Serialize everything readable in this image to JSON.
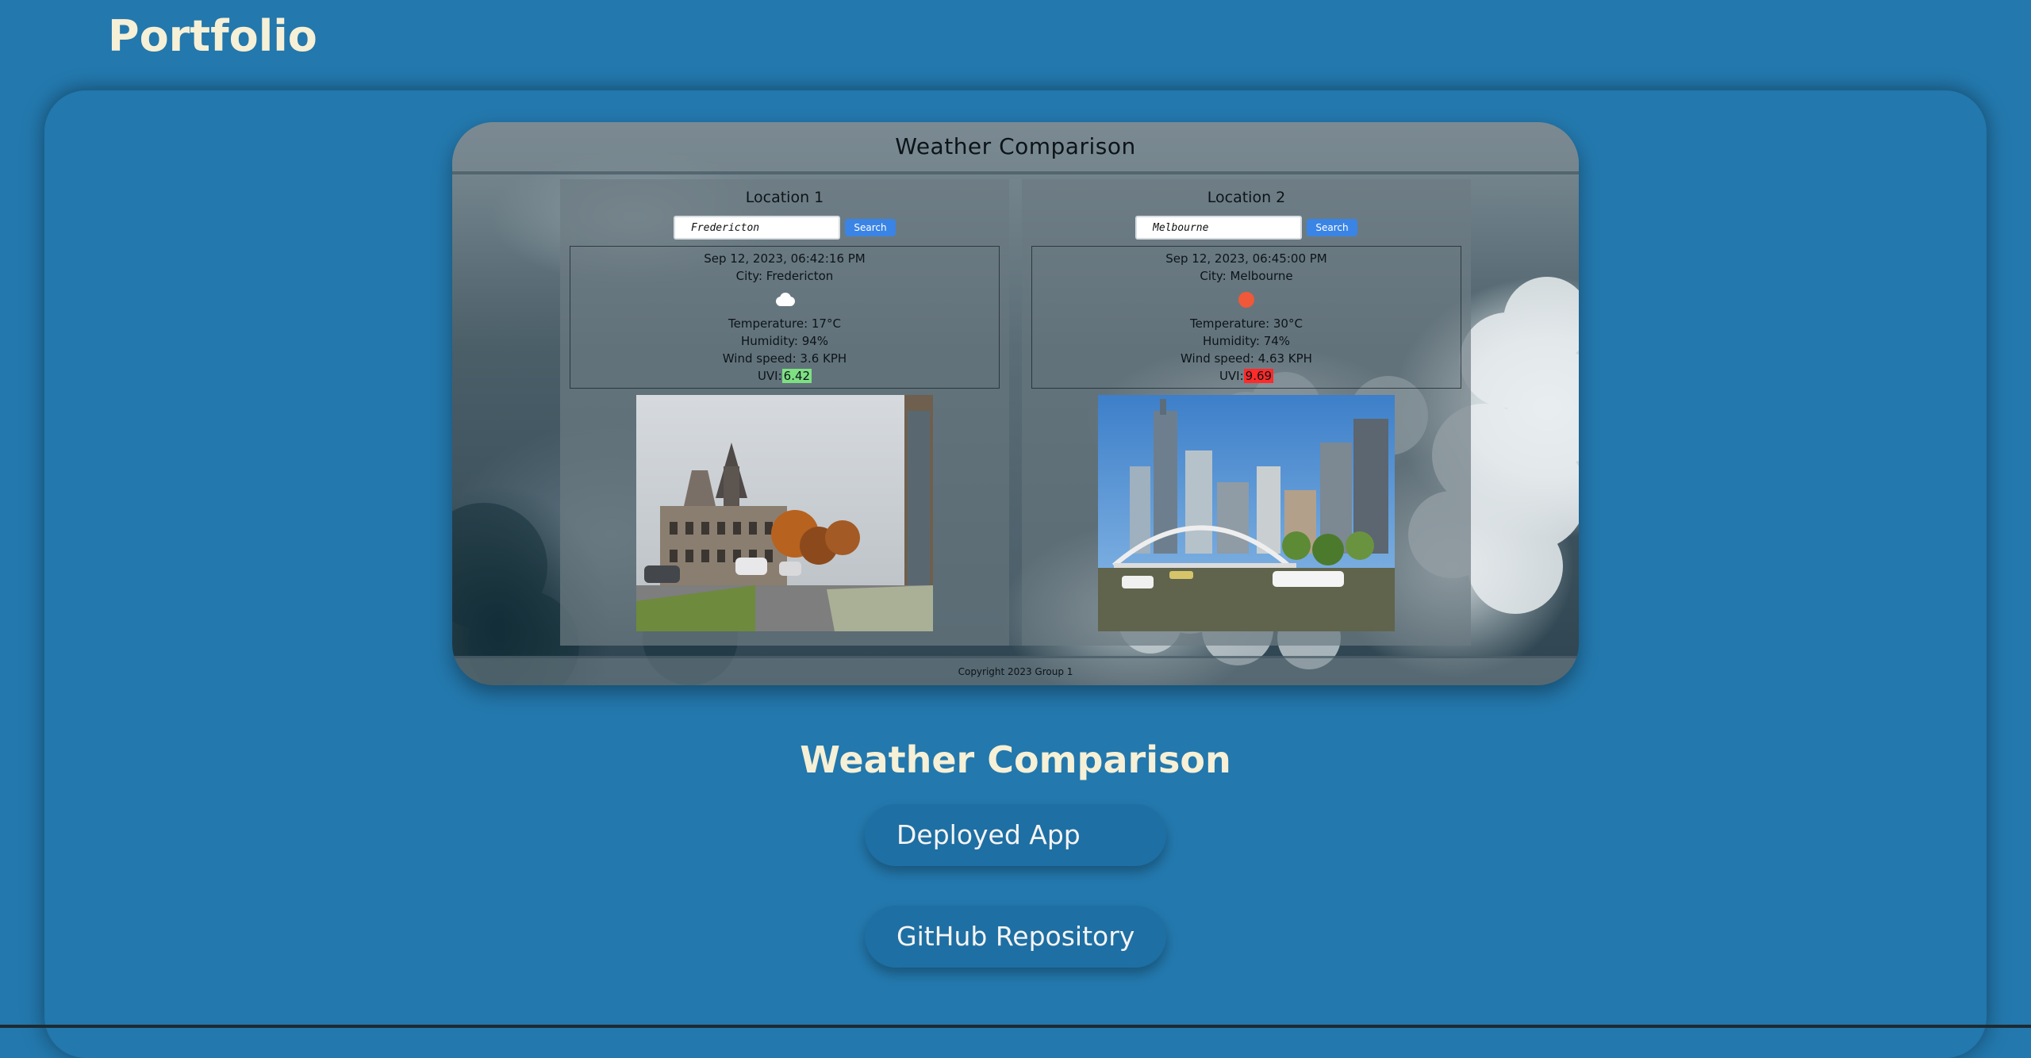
{
  "page": {
    "title": "Portfolio"
  },
  "screenshot": {
    "app_title": "Weather Comparison",
    "footer": "Copyright 2023 Group 1",
    "locations": [
      {
        "heading": "Location 1",
        "search_value": "Fredericton",
        "search_button": "Search",
        "datetime": "Sep 12, 2023, 06:42:16 PM",
        "city": "City: Fredericton",
        "weather_icon": "cloud-icon",
        "temperature": "Temperature: 17°C",
        "humidity": "Humidity: 94%",
        "wind": "Wind speed: 3.6 KPH",
        "uvi_label": "UVI:",
        "uvi_value": "6.42",
        "uvi_color": "#7ee083",
        "photo": "fredericton-photo"
      },
      {
        "heading": "Location 2",
        "search_value": "Melbourne",
        "search_button": "Search",
        "datetime": "Sep 12, 2023, 06:45:00 PM",
        "city": "City: Melbourne",
        "weather_icon": "sun-icon",
        "temperature": "Temperature: 30°C",
        "humidity": "Humidity: 74%",
        "wind": "Wind speed: 4.63 KPH",
        "uvi_label": "UVI:",
        "uvi_value": "9.69",
        "uvi_color": "#ff2a2a",
        "photo": "melbourne-photo"
      }
    ]
  },
  "project": {
    "title": "Weather Comparison",
    "deployed_label": "Deployed App",
    "github_label": "GitHub Repository"
  },
  "colors": {
    "background": "#2378ad",
    "heading_text": "#f6f0d6",
    "button_bg": "#1e6fa3",
    "search_button": "#3a84e6"
  }
}
